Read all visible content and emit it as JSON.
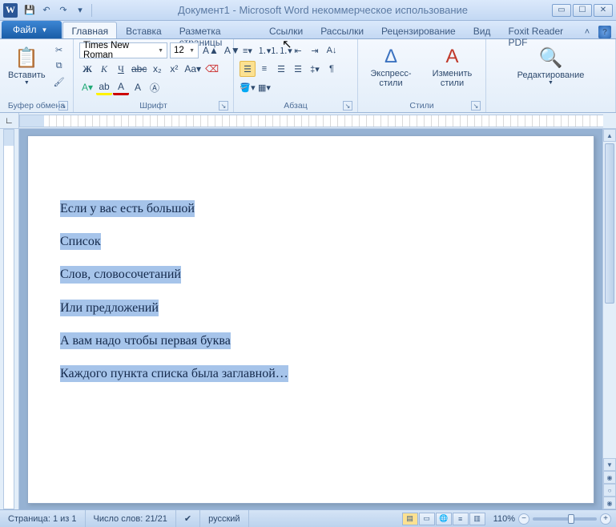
{
  "title": "Документ1 - Microsoft Word некоммерческое использование",
  "file_tab": "Файл",
  "tabs": [
    "Главная",
    "Вставка",
    "Разметка страницы",
    "Ссылки",
    "Рассылки",
    "Рецензирование",
    "Вид",
    "Foxit Reader PDF"
  ],
  "active_tab": 0,
  "ribbon": {
    "clipboard": {
      "paste": "Вставить",
      "label": "Буфер обмена"
    },
    "font": {
      "name": "Times New Roman",
      "size": "12",
      "label": "Шрифт"
    },
    "paragraph": {
      "label": "Абзац"
    },
    "styles": {
      "quick": "Экспресс-стили",
      "change": "Изменить стили",
      "label": "Стили"
    },
    "editing": {
      "btn": "Редактирование"
    }
  },
  "document": {
    "lines": [
      "Если у вас есть большой",
      "Список",
      "Слов, словосочетаний",
      "Или предложений",
      "А вам надо чтобы первая буква",
      "Каждого пункта списка была заглавной…"
    ]
  },
  "statusbar": {
    "page": "Страница: 1 из 1",
    "words": "Число слов: 21/21",
    "lang": "русский",
    "zoom": "110%"
  }
}
